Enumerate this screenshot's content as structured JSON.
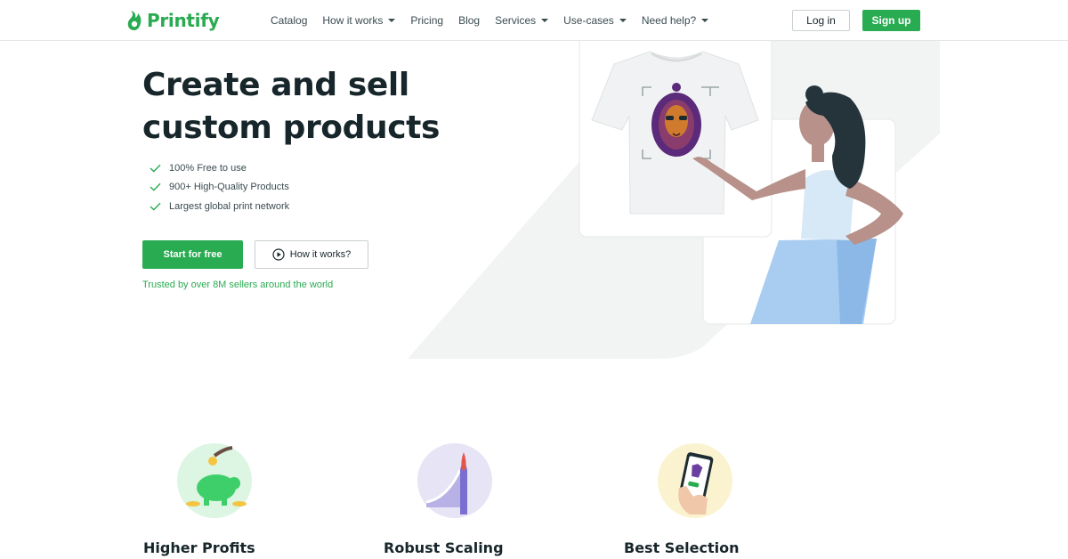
{
  "header": {
    "brand": "Printify",
    "nav": [
      {
        "label": "Catalog",
        "has_caret": false
      },
      {
        "label": "How it works",
        "has_caret": true
      },
      {
        "label": "Pricing",
        "has_caret": false
      },
      {
        "label": "Blog",
        "has_caret": false
      },
      {
        "label": "Services",
        "has_caret": true
      },
      {
        "label": "Use-cases",
        "has_caret": true
      },
      {
        "label": "Need help?",
        "has_caret": true
      }
    ],
    "login_label": "Log in",
    "signup_label": "Sign up"
  },
  "hero": {
    "title": "Create and sell custom products",
    "features": [
      "100% Free to use",
      "900+ High-Quality Products",
      "Largest global print network"
    ],
    "start_label": "Start for free",
    "how_label": "How it works?",
    "trusted": "Trusted by over 8M sellers around the world"
  },
  "benefits": [
    {
      "title": "Higher Profits",
      "icon": "piggy-bank-icon"
    },
    {
      "title": "Robust Scaling",
      "icon": "rocket-growth-icon"
    },
    {
      "title": "Best Selection",
      "icon": "phone-shirt-icon"
    }
  ],
  "colors": {
    "brand_green": "#29ab51",
    "text_dark": "#17262b",
    "hero_shape": "#f2f3f3"
  }
}
